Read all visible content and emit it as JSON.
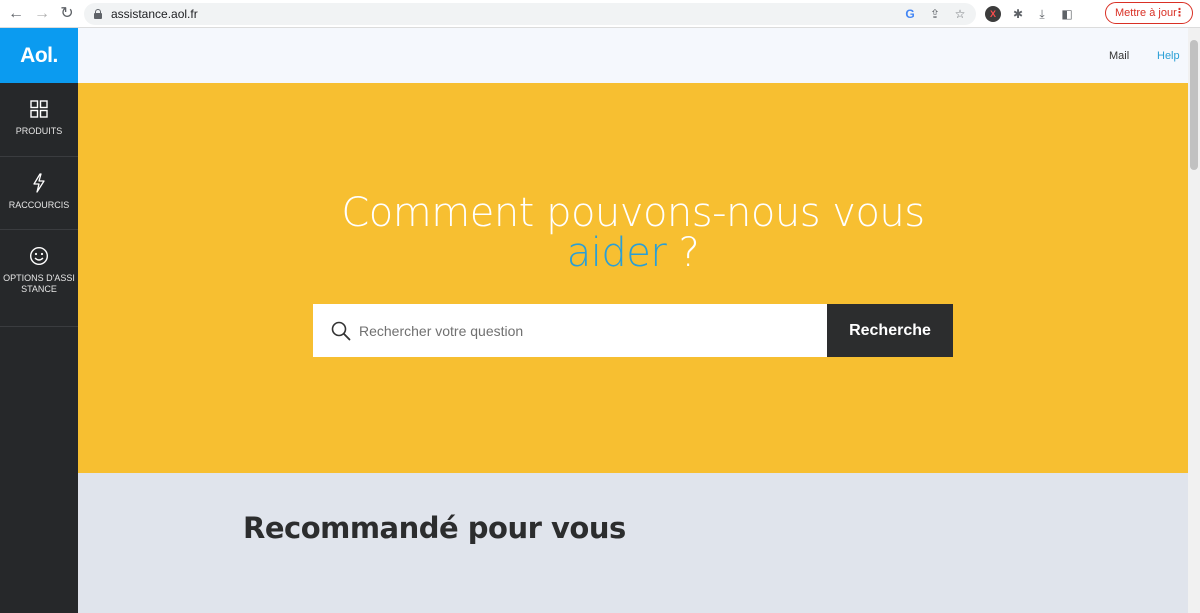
{
  "browser": {
    "url": "assistance.aol.fr",
    "update_button_label": "Mettre à jour",
    "update_button_menu": "⋮",
    "extension_label": "X"
  },
  "sidebar": {
    "logo": "Aol.",
    "items": [
      {
        "label": "PRODUITS",
        "icon": "grid-icon"
      },
      {
        "label": "RACCOURCIS",
        "icon": "lightning-icon"
      },
      {
        "label": "OPTIONS D'ASSISTANCE",
        "icon": "smiley-icon"
      }
    ]
  },
  "header": {
    "links": [
      {
        "label": "Mail",
        "color": "#333333"
      },
      {
        "label": "Help",
        "color": "#2a9fd6"
      }
    ]
  },
  "hero": {
    "headline_line1": "Comment pouvons-nous vous",
    "headline_accent": "aider",
    "headline_end": " ?",
    "search_placeholder": "Rechercher votre question",
    "search_button": "Recherche"
  },
  "recommended": {
    "title": "Recommandé pour vous"
  },
  "colors": {
    "hero_bg": "#f7bf31",
    "logo_bg": "#0b9bf0",
    "sidebar_bg": "#26282a",
    "accent": "#2a9fd6"
  }
}
